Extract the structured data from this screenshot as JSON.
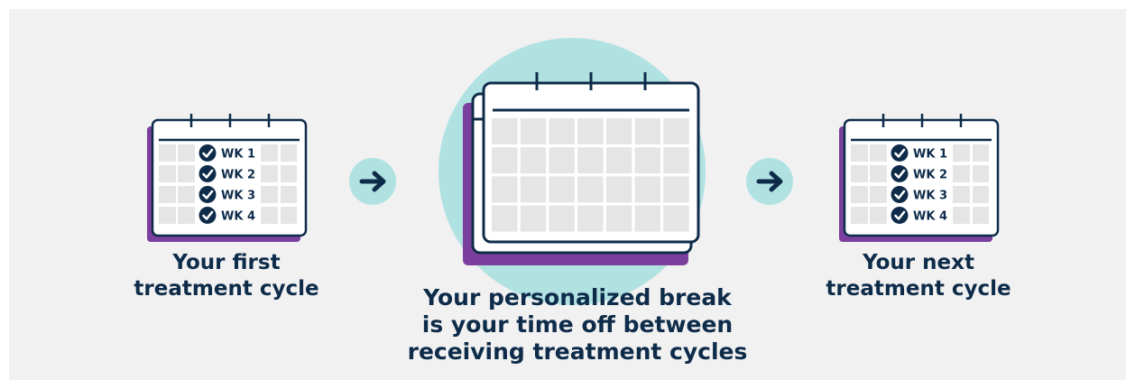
{
  "panels": [
    {
      "id": "first",
      "weeks": [
        "WK 1",
        "WK 2",
        "WK 3",
        "WK 4"
      ],
      "caption_lines": [
        "Your first",
        "treatment cycle"
      ]
    },
    {
      "id": "break",
      "caption_lines": [
        "Your personalized break",
        "is your time off between",
        "receiving treatment cycles"
      ]
    },
    {
      "id": "next",
      "weeks": [
        "WK 1",
        "WK 2",
        "WK 3",
        "WK 4"
      ],
      "caption_lines": [
        "Your next",
        "treatment cycle"
      ]
    }
  ],
  "arrows": [
    {
      "icon": "arrow-right-icon"
    },
    {
      "icon": "arrow-right-icon"
    }
  ],
  "colors": {
    "background": "#f1f1f1",
    "navy": "#0e2c4a",
    "purple": "#7b3f9e",
    "teal": "#b1e2e2",
    "cell": "#e5e5e5",
    "white": "#ffffff"
  }
}
